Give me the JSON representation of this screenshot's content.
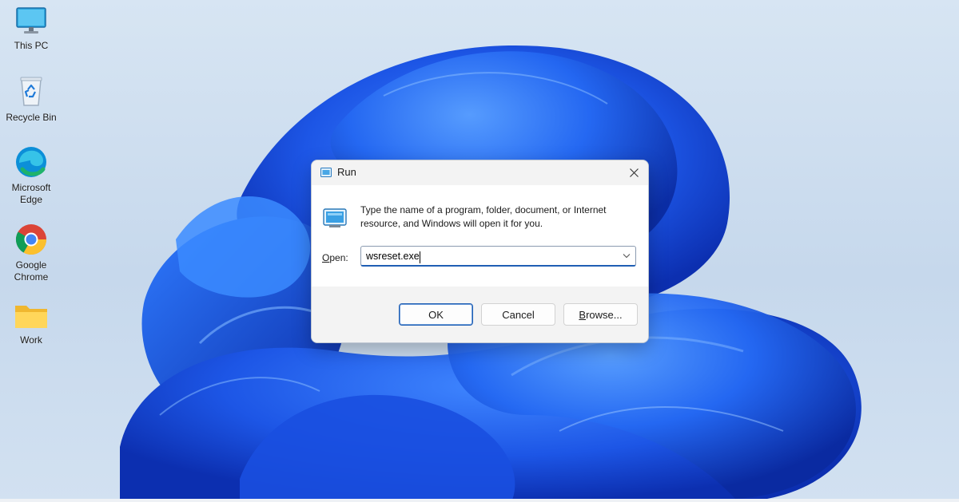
{
  "desktop": {
    "icons": [
      {
        "label": "This PC",
        "icon": "monitor-icon"
      },
      {
        "label": "Recycle Bin",
        "icon": "recycle-bin-icon"
      },
      {
        "label": "Microsoft Edge",
        "icon": "edge-icon"
      },
      {
        "label": "Google Chrome",
        "icon": "chrome-icon"
      },
      {
        "label": "Work",
        "icon": "folder-icon"
      }
    ]
  },
  "run_dialog": {
    "title": "Run",
    "description": "Type the name of a program, folder, document, or Internet resource, and Windows will open it for you.",
    "open_label_prefix": "O",
    "open_label_rest": "pen:",
    "open_value": "wsreset.exe",
    "buttons": {
      "ok": "OK",
      "cancel": "Cancel",
      "browse_prefix": "B",
      "browse_rest": "rowse..."
    }
  },
  "colors": {
    "accent": "#1f5fb4",
    "wallpaper_blue": "#1e5ef0",
    "dialog_bg": "#f3f3f3"
  }
}
